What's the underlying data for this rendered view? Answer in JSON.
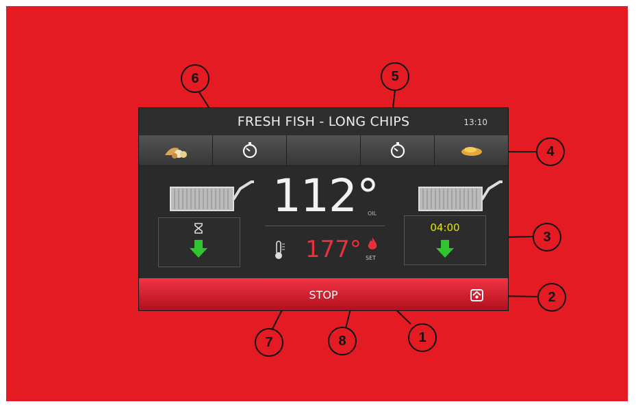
{
  "header": {
    "title": "FRESH FISH - LONG CHIPS",
    "time": "13:10"
  },
  "tabs": [
    {
      "icon": "fish-icon"
    },
    {
      "icon": "timer-icon"
    },
    {
      "icon": "empty"
    },
    {
      "icon": "timer-icon"
    },
    {
      "icon": "chips-icon"
    }
  ],
  "left_basket": {
    "timer_icon": "hourglass-icon",
    "action_icon": "down-arrow-icon"
  },
  "right_basket": {
    "timer": "04:00",
    "action_icon": "down-arrow-icon"
  },
  "oil_temp": {
    "value": "112°",
    "label": "OIL"
  },
  "set_temp": {
    "value": "177°",
    "label": "SET"
  },
  "stop_bar": {
    "label": "STOP"
  },
  "callouts": [
    "1",
    "2",
    "3",
    "4",
    "5",
    "6",
    "7",
    "8"
  ],
  "colors": {
    "background": "#e41b23",
    "panel": "#2a2a2a",
    "stop_bar": "#d81f2e",
    "set_temp": "#e8323b",
    "timer_text": "#e6e600",
    "arrow": "#2ec52e"
  }
}
